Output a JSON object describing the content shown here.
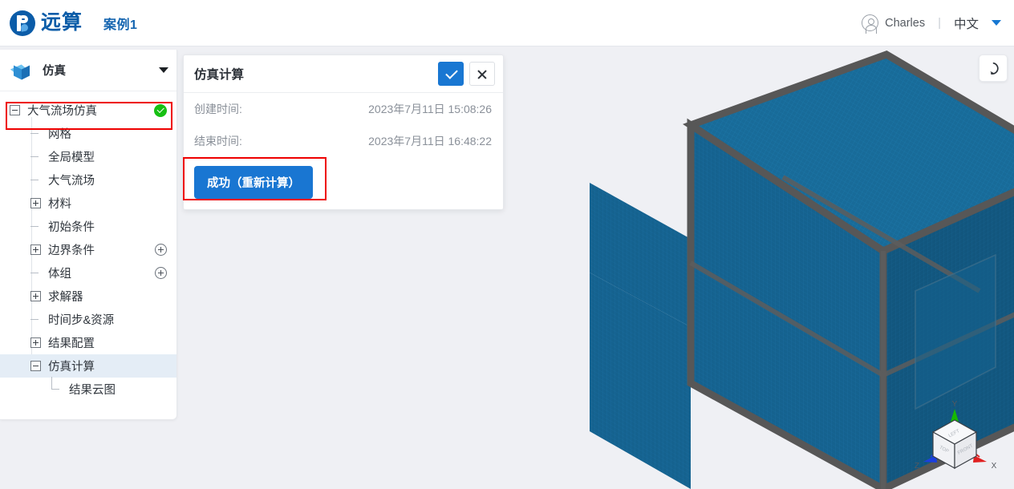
{
  "header": {
    "logo_text": "远算",
    "logo_icon": "yuansuan-logo-icon",
    "case_title": "案例1",
    "user_name": "Charles",
    "user_icon": "user-avatar-icon",
    "separator": "|",
    "language": "中文",
    "caret_icon": "chevron-down-icon"
  },
  "sidebar": {
    "icon": "blue-cube-icon",
    "title": "仿真",
    "collapse_icon": "chevron-down-icon",
    "tree": [
      {
        "label": "大气流场仿真",
        "depth": 0,
        "toggle": "minus",
        "badge": "success-check-icon",
        "selected": false
      },
      {
        "label": "网格",
        "depth": 1,
        "toggle": "dash",
        "badge": null,
        "selected": false
      },
      {
        "label": "全局模型",
        "depth": 1,
        "toggle": "dash",
        "badge": null,
        "selected": false
      },
      {
        "label": "大气流场",
        "depth": 1,
        "toggle": "dash",
        "badge": null,
        "selected": false
      },
      {
        "label": "材料",
        "depth": 1,
        "toggle": "plus",
        "badge": null,
        "selected": false
      },
      {
        "label": "初始条件",
        "depth": 1,
        "toggle": "dash",
        "badge": null,
        "selected": false
      },
      {
        "label": "边界条件",
        "depth": 1,
        "toggle": "plus",
        "badge": "add-circle-icon",
        "selected": false
      },
      {
        "label": "体组",
        "depth": 1,
        "toggle": "dash",
        "badge": "add-circle-icon",
        "selected": false
      },
      {
        "label": "求解器",
        "depth": 1,
        "toggle": "plus",
        "badge": null,
        "selected": false
      },
      {
        "label": "时间步&资源",
        "depth": 1,
        "toggle": "dash",
        "badge": null,
        "selected": false
      },
      {
        "label": "结果配置",
        "depth": 1,
        "toggle": "plus",
        "badge": null,
        "selected": false
      },
      {
        "label": "仿真计算",
        "depth": 1,
        "toggle": "minus",
        "badge": null,
        "selected": true
      },
      {
        "label": "结果云图",
        "depth": 2,
        "toggle": "elbow",
        "badge": null,
        "selected": false
      }
    ]
  },
  "dialog": {
    "title": "仿真计算",
    "confirm_icon": "check-icon",
    "close_icon": "close-icon",
    "rows": [
      {
        "label": "创建时间:",
        "value": "2023年7月11日 15:08:26"
      },
      {
        "label": "结束时间:",
        "value": "2023年7月11日 16:48:22"
      }
    ],
    "primary_button": "成功（重新计算）"
  },
  "viewport": {
    "reset_icon": "refresh-rotate-icon",
    "gizmo": {
      "axis_x": "X",
      "axis_y": "Y",
      "axis_z": "Z",
      "face_top": "TOP",
      "face_left": "LEFT",
      "face_front": "FRONT",
      "color_x": "#e02020",
      "color_y": "#16b900",
      "color_z": "#1b3fe0"
    },
    "model_name": "meshed-box-model",
    "mesh_color": "#15628f",
    "edge_color": "#575757"
  },
  "annotations": {
    "box_tree": "大气流场仿真",
    "box_button": "成功（重新计算）",
    "color": "#ee0000"
  }
}
